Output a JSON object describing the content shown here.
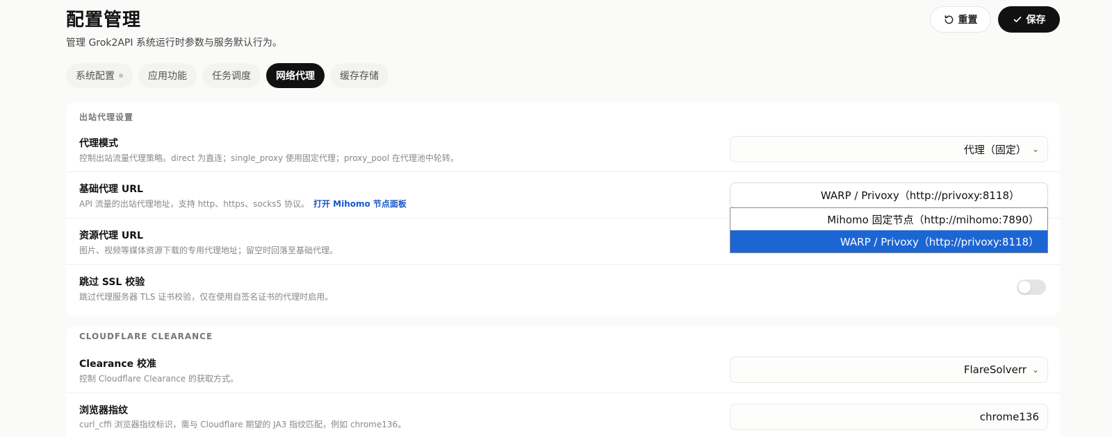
{
  "header": {
    "title": "配置管理",
    "subtitle": "管理 Grok2API 系统运行时参数与服务默认行为。",
    "reset_label": "重置",
    "save_label": "保存"
  },
  "tabs": [
    {
      "label": "系统配置"
    },
    {
      "label": "应用功能"
    },
    {
      "label": "任务调度"
    },
    {
      "label": "网络代理",
      "active": true
    },
    {
      "label": "缓存存储"
    }
  ],
  "proxy_section": {
    "title": "出站代理设置",
    "proxy_mode": {
      "label": "代理模式",
      "desc": "控制出站流量代理策略。direct 为直连；single_proxy 使用固定代理；proxy_pool 在代理池中轮转。",
      "value": "代理（固定）"
    },
    "base_proxy": {
      "label": "基础代理 URL",
      "desc": "API 流量的出站代理地址，支持 http、https、socks5 协议。",
      "link": "打开 Mihomo 节点面板",
      "value": "WARP / Privoxy（http://privoxy:8118）",
      "options": [
        "Mihomo 固定节点（http://mihomo:7890）",
        "WARP / Privoxy（http://privoxy:8118）"
      ]
    },
    "resource_proxy": {
      "label": "资源代理 URL",
      "desc": "图片、视频等媒体资源下载的专用代理地址；留空时回落至基础代理。"
    },
    "skip_ssl": {
      "label": "跳过 SSL 校验",
      "desc": "跳过代理服务器 TLS 证书校验，仅在使用自签名证书的代理时启用。",
      "enabled": false
    }
  },
  "cloudflare_section": {
    "title": "CLOUDFLARE CLEARANCE",
    "clearance": {
      "label": "Clearance 校准",
      "desc": "控制 Cloudflare Clearance 的获取方式。",
      "value": "FlareSolverr"
    },
    "fingerprint": {
      "label": "浏览器指纹",
      "desc": "curl_cffi 浏览器指纹标识，需与 Cloudflare 期望的 JA3 指纹匹配，例如 chrome136。",
      "value": "chrome136"
    }
  },
  "colors": {
    "accent": "#1c66d4",
    "primary_button": "#111111",
    "link": "#1a56c9"
  }
}
